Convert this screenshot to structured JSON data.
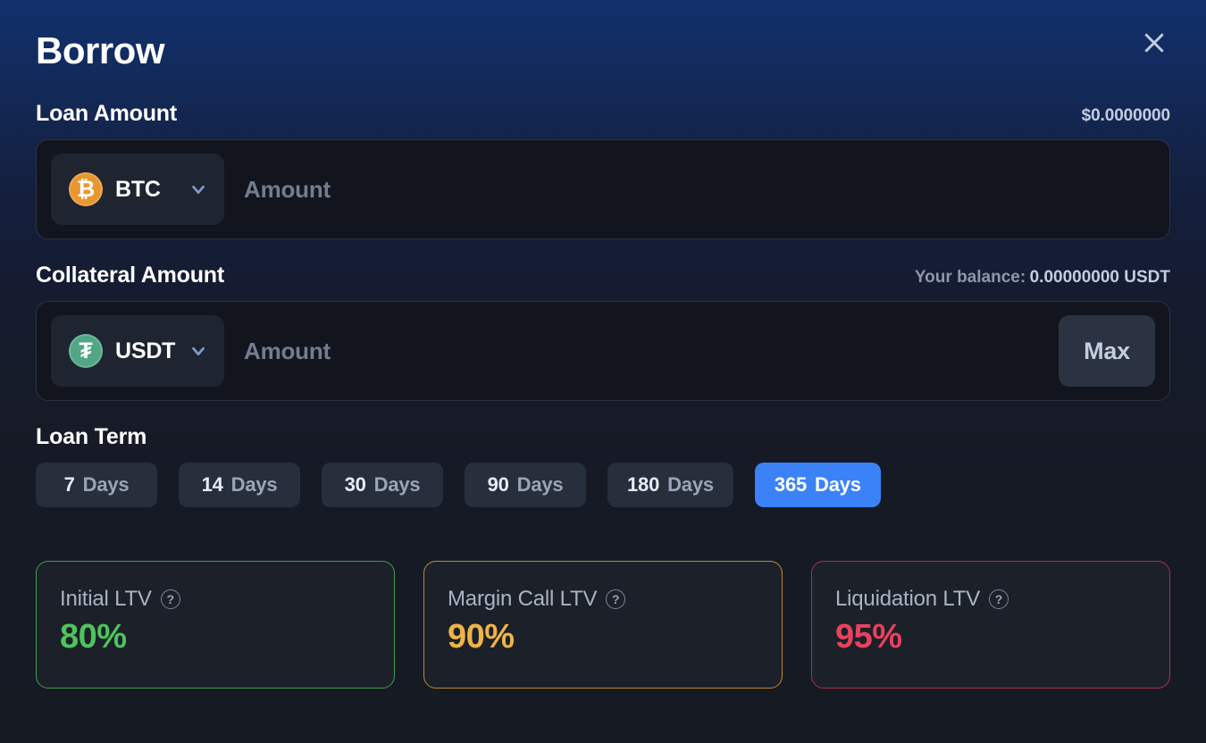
{
  "modal": {
    "title": "Borrow",
    "close_label": "×"
  },
  "loan_amount": {
    "label": "Loan Amount",
    "usd_value": "$0.0000000",
    "asset": "BTC",
    "asset_icon": "bitcoin-icon",
    "asset_symbol": "₿",
    "input_value": "",
    "input_placeholder": "Amount"
  },
  "collateral_amount": {
    "label": "Collateral Amount",
    "balance_label": "Your balance:",
    "balance_value": "0.00000000 USDT",
    "asset": "USDT",
    "asset_icon": "tether-icon",
    "asset_symbol": "₮",
    "input_value": "",
    "input_placeholder": "Amount",
    "max_label": "Max"
  },
  "loan_term": {
    "label": "Loan Term",
    "unit": "Days",
    "options": [
      {
        "value": "7",
        "unit": "Days",
        "selected": false
      },
      {
        "value": "14",
        "unit": "Days",
        "selected": false
      },
      {
        "value": "30",
        "unit": "Days",
        "selected": false
      },
      {
        "value": "90",
        "unit": "Days",
        "selected": false
      },
      {
        "value": "180",
        "unit": "Days",
        "selected": false
      },
      {
        "value": "365",
        "unit": "Days",
        "selected": true
      }
    ]
  },
  "ltv_cards": [
    {
      "name": "Initial LTV",
      "value": "80%",
      "help": "?",
      "color": "#4ec45c",
      "border": "#3f9e4d"
    },
    {
      "name": "Margin Call LTV",
      "value": "90%",
      "help": "?",
      "color": "#efb348",
      "border": "#b98c32"
    },
    {
      "name": "Liquidation LTV",
      "value": "95%",
      "help": "?",
      "color": "#e8415c",
      "border": "#a8324a"
    }
  ],
  "colors": {
    "accent_blue": "#3b82f6",
    "btc_orange": "#e8962f",
    "usdt_green": "#50a685",
    "header_gradient_top": "#12306b",
    "page_background": "#161a24"
  }
}
